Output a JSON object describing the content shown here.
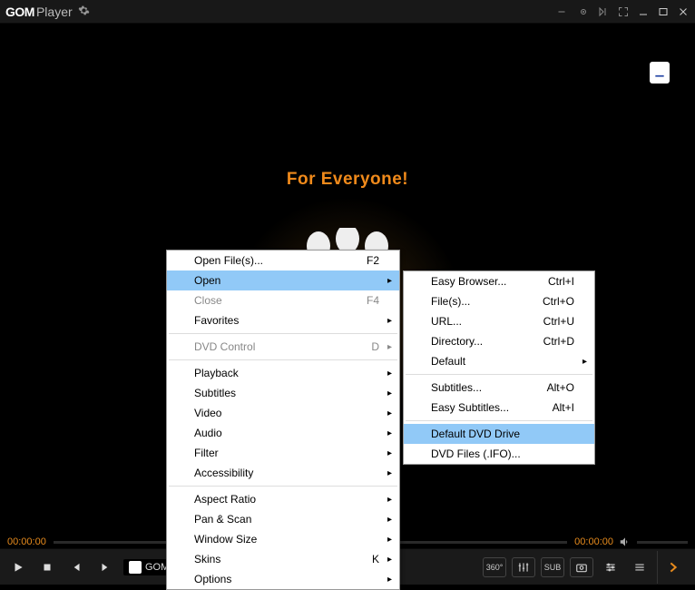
{
  "app": {
    "name1": "GOM",
    "name2": "Player"
  },
  "tagline": "For Everyone!",
  "timeline": {
    "left": "00:00:00",
    "right": "00:00:00"
  },
  "file_chip": "GOM",
  "right_buttons": {
    "b360": "360°",
    "sub": "SUB"
  },
  "main_menu": {
    "items": [
      {
        "label": "Open File(s)...",
        "shortcut": "F2",
        "enabled": true,
        "submenu": false
      },
      {
        "label": "Open",
        "shortcut": "",
        "enabled": true,
        "submenu": true,
        "highlight": true
      },
      {
        "label": "Close",
        "shortcut": "F4",
        "enabled": false,
        "submenu": false
      },
      {
        "label": "Favorites",
        "shortcut": "",
        "enabled": true,
        "submenu": true
      },
      {
        "sep": true
      },
      {
        "label": "DVD Control",
        "shortcut": "D",
        "enabled": false,
        "submenu": true
      },
      {
        "sep": true
      },
      {
        "label": "Playback",
        "shortcut": "",
        "enabled": true,
        "submenu": true
      },
      {
        "label": "Subtitles",
        "shortcut": "",
        "enabled": true,
        "submenu": true
      },
      {
        "label": "Video",
        "shortcut": "",
        "enabled": true,
        "submenu": true
      },
      {
        "label": "Audio",
        "shortcut": "",
        "enabled": true,
        "submenu": true
      },
      {
        "label": "Filter",
        "shortcut": "",
        "enabled": true,
        "submenu": true
      },
      {
        "label": "Accessibility",
        "shortcut": "",
        "enabled": true,
        "submenu": true
      },
      {
        "sep": true
      },
      {
        "label": "Aspect Ratio",
        "shortcut": "",
        "enabled": true,
        "submenu": true
      },
      {
        "label": "Pan & Scan",
        "shortcut": "",
        "enabled": true,
        "submenu": true
      },
      {
        "label": "Window Size",
        "shortcut": "",
        "enabled": true,
        "submenu": true
      },
      {
        "label": "Skins",
        "shortcut": "K",
        "enabled": true,
        "submenu": true
      },
      {
        "label": "Options",
        "shortcut": "",
        "enabled": true,
        "submenu": true
      }
    ]
  },
  "sub_menu": {
    "items": [
      {
        "label": "Easy Browser...",
        "shortcut": "Ctrl+I",
        "enabled": true,
        "submenu": false
      },
      {
        "label": "File(s)...",
        "shortcut": "Ctrl+O",
        "enabled": true,
        "submenu": false
      },
      {
        "label": "URL...",
        "shortcut": "Ctrl+U",
        "enabled": true,
        "submenu": false
      },
      {
        "label": "Directory...",
        "shortcut": "Ctrl+D",
        "enabled": true,
        "submenu": false
      },
      {
        "label": "Default",
        "shortcut": "",
        "enabled": true,
        "submenu": true
      },
      {
        "sep": true
      },
      {
        "label": "Subtitles...",
        "shortcut": "Alt+O",
        "enabled": true,
        "submenu": false
      },
      {
        "label": "Easy Subtitles...",
        "shortcut": "Alt+I",
        "enabled": true,
        "submenu": false
      },
      {
        "sep": true
      },
      {
        "label": "Default DVD Drive",
        "shortcut": "",
        "enabled": true,
        "submenu": false,
        "highlight": true
      },
      {
        "label": "DVD Files (.IFO)...",
        "shortcut": "",
        "enabled": true,
        "submenu": false
      }
    ]
  }
}
